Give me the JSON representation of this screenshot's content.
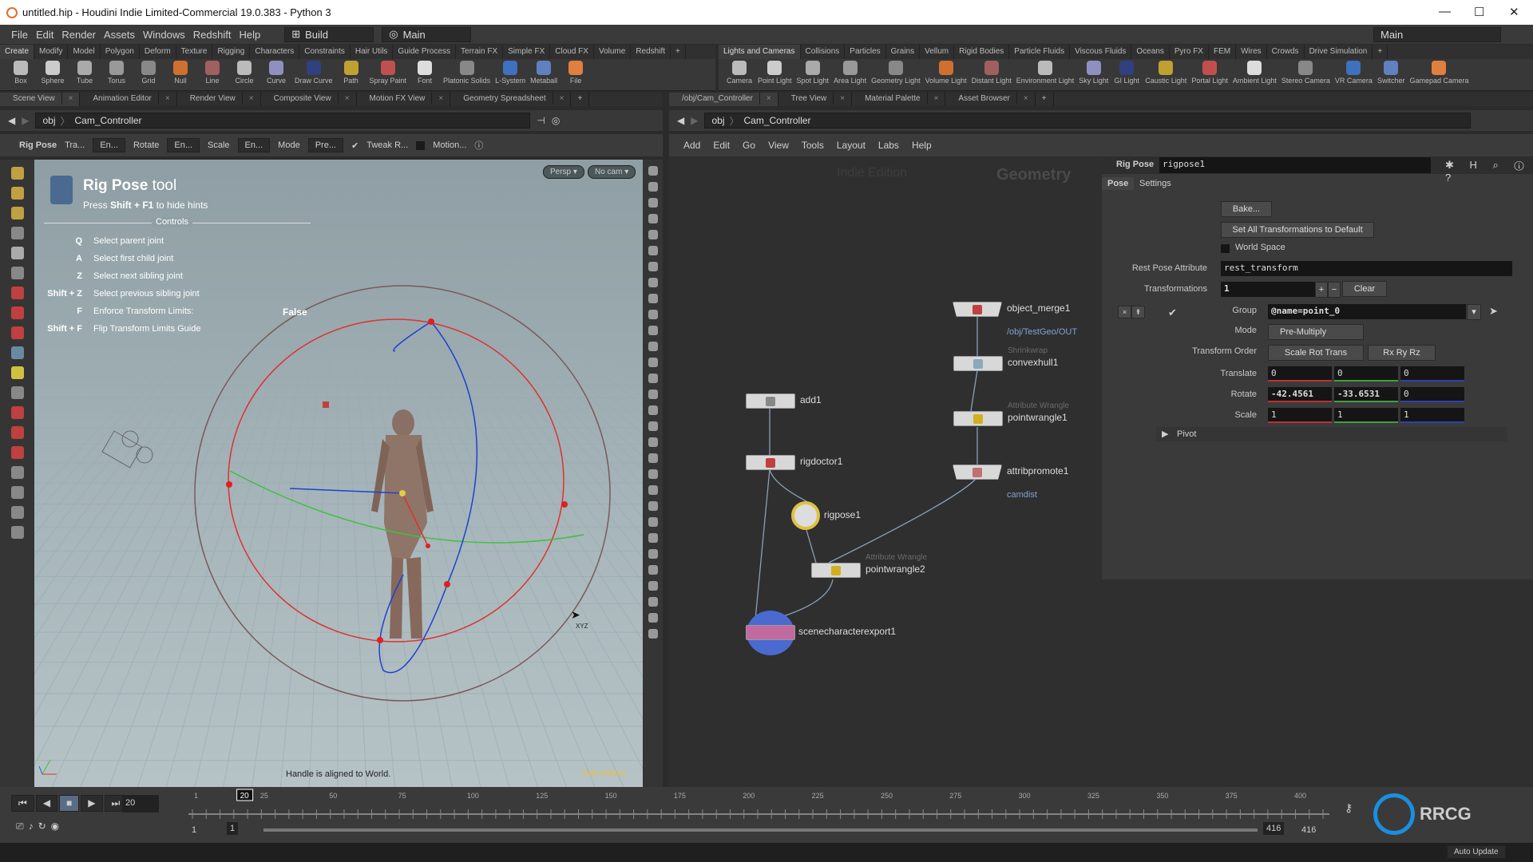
{
  "window": {
    "title": "untitled.hip - Houdini Indie Limited-Commercial 19.0.383 - Python 3"
  },
  "menubar": {
    "items": [
      "File",
      "Edit",
      "Render",
      "Assets",
      "Windows",
      "Redshift",
      "Help"
    ],
    "desktop": "Build",
    "context": "Main",
    "right_context": "Main"
  },
  "shelf_left": {
    "tabs": [
      "Create",
      "Modify",
      "Model",
      "Polygon",
      "Deform",
      "Texture",
      "Rigging",
      "Characters",
      "Constraints",
      "Hair Utils",
      "Guide Process",
      "Terrain FX",
      "Simple FX",
      "Cloud FX",
      "Volume",
      "Redshift"
    ],
    "tools": [
      "Box",
      "Sphere",
      "Tube",
      "Torus",
      "Grid",
      "Null",
      "Line",
      "Circle",
      "Curve",
      "Draw Curve",
      "Path",
      "Spray Paint",
      "Font",
      "Platonic Solids",
      "L-System",
      "Metaball",
      "File"
    ]
  },
  "shelf_right": {
    "tabs": [
      "Lights and Cameras",
      "Collisions",
      "Particles",
      "Grains",
      "Vellum",
      "Rigid Bodies",
      "Particle Fluids",
      "Viscous Fluids",
      "Oceans",
      "Pyro FX",
      "FEM",
      "Wires",
      "Crowds",
      "Drive Simulation"
    ],
    "tools": [
      "Camera",
      "Point Light",
      "Spot Light",
      "Area Light",
      "Geometry Light",
      "Volume Light",
      "Distant Light",
      "Environment Light",
      "Sky Light",
      "GI Light",
      "Caustic Light",
      "Portal Light",
      "Ambient Light",
      "Stereo Camera",
      "VR Camera",
      "Switcher",
      "Gamepad Camera"
    ]
  },
  "left_pane": {
    "tabs": [
      "Scene View",
      "Animation Editor",
      "Render View",
      "Composite View",
      "Motion FX View",
      "Geometry Spreadsheet"
    ],
    "path": [
      "obj",
      "Cam_Controller"
    ],
    "tool_options": {
      "tool": "Rig Pose",
      "translate_label": "Tra...",
      "translate_value": "En...",
      "rotate_label": "Rotate",
      "rotate_value": "En...",
      "scale_label": "Scale",
      "scale_value": "En...",
      "mode_label": "Mode",
      "mode_value": "Pre...",
      "tweak_label": "Tweak R...",
      "tweak_checked": true,
      "motion_label": "Motion...",
      "motion_checked": false
    }
  },
  "viewport": {
    "persp": "Persp ▾",
    "camera": "No cam ▾",
    "hint_title_bold": "Rig Pose",
    "hint_title_rest": " tool",
    "hint_sub_pre": "Press ",
    "hint_sub_keys": "Shift + F1",
    "hint_sub_post": " to hide hints",
    "controls_heading": "Controls",
    "controls": [
      {
        "key": "Q",
        "desc": "Select parent joint"
      },
      {
        "key": "A",
        "desc": "Select first child joint"
      },
      {
        "key": "Z",
        "desc": "Select next sibling joint"
      },
      {
        "key": "Shift + Z",
        "desc": "Select previous sibling joint"
      },
      {
        "key": "F",
        "desc": "Enforce Transform Limits:",
        "value": "False"
      },
      {
        "key": "Shift + F",
        "desc": "Flip Transform Limits Guide"
      }
    ],
    "status": "Handle is aligned to World.",
    "edition": "Indie Edition",
    "cursor_label": "XYZ",
    "axis_colors": {
      "x": "#e03030",
      "y": "#40c040",
      "z": "#3050e0"
    }
  },
  "right_pane": {
    "tabs": [
      "/obj/Cam_Controller",
      "Tree View",
      "Material Palette",
      "Asset Browser"
    ],
    "path": [
      "obj",
      "Cam_Controller"
    ],
    "menu": [
      "Add",
      "Edit",
      "Go",
      "View",
      "Tools",
      "Layout",
      "Labs",
      "Help"
    ],
    "network_watermark": "Indie Edition",
    "network_context": "Geometry"
  },
  "network": {
    "nodes": [
      {
        "name": "object_merge1",
        "type": "",
        "comment": "/obj/TestGeo/OUT"
      },
      {
        "name": "convexhull1",
        "type": "Shrinkwrap",
        "comment": ""
      },
      {
        "name": "pointwrangle1",
        "type": "Attribute Wrangle",
        "comment": ""
      },
      {
        "name": "attribpromote1",
        "type": "",
        "comment": "camdist"
      },
      {
        "name": "add1",
        "type": "",
        "comment": ""
      },
      {
        "name": "rigdoctor1",
        "type": "",
        "comment": ""
      },
      {
        "name": "rigpose1",
        "type": "",
        "comment": "",
        "selected": true
      },
      {
        "name": "pointwrangle2",
        "type": "Attribute Wrangle",
        "comment": ""
      },
      {
        "name": "scenecharacterexport1",
        "type": "",
        "comment": ""
      }
    ]
  },
  "params": {
    "node_type": "Rig Pose",
    "node_name": "rigpose1",
    "tabs": [
      "Pose",
      "Settings"
    ],
    "bake": "Bake...",
    "set_default": "Set All Transformations to Default",
    "world_space": "World Space",
    "world_space_checked": false,
    "rest_pose_label": "Rest Pose Attribute",
    "rest_pose_value": "rest_transform",
    "transformations_label": "Transformations",
    "transformations_value": "1",
    "clear": "Clear",
    "group_label": "Group",
    "group_value": "@name=point_0",
    "mode_label": "Mode",
    "mode_value": "Pre-Multiply",
    "order_label": "Transform Order",
    "order_value": "Scale Rot Trans",
    "rot_order_value": "Rx Ry Rz",
    "translate_label": "Translate",
    "translate": [
      "0",
      "0",
      "0"
    ],
    "rotate_label": "Rotate",
    "rotate": [
      "-42.4561",
      "-33.6531",
      "0"
    ],
    "scale_label": "Scale",
    "scale": [
      "1",
      "1",
      "1"
    ],
    "pivot": "Pivot"
  },
  "timeline": {
    "current_frame": "20",
    "frame_field": "20",
    "start": 1,
    "end": 400,
    "tick_labels": [
      "1",
      "25",
      "50",
      "75",
      "100",
      "125",
      "150",
      "175",
      "200",
      "225",
      "250",
      "275",
      "300",
      "325",
      "350",
      "375",
      "400"
    ],
    "range_start": "1",
    "range_start2": "1",
    "range_end": "416",
    "range_end2": "416"
  },
  "status": {
    "auto_update": "Auto Update"
  },
  "watermark": "RRCG 人人素材"
}
